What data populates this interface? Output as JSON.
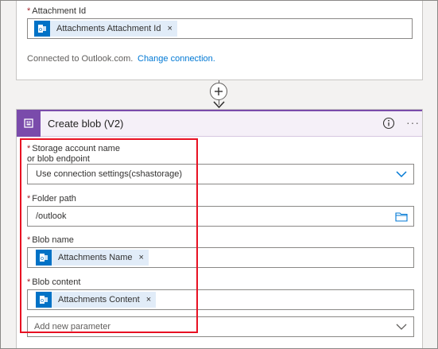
{
  "outlook_step": {
    "attachment_id": {
      "label": "Attachment Id",
      "required_mark": "*",
      "token_label": "Attachments Attachment Id",
      "token_remove": "×"
    },
    "connection_text": "Connected to Outlook.com.",
    "change_connection_link": "Change connection."
  },
  "create_blob_step": {
    "title": "Create blob (V2)",
    "more_label": "···",
    "fields": {
      "storage_account": {
        "required_mark": "*",
        "label_line1": "Storage account name",
        "label_line2": "or blob endpoint",
        "value": "Use connection settings(cshastorage)"
      },
      "folder_path": {
        "required_mark": "*",
        "label": "Folder path",
        "value": "/outlook"
      },
      "blob_name": {
        "required_mark": "*",
        "label": "Blob name",
        "token_label": "Attachments Name",
        "token_remove": "×"
      },
      "blob_content": {
        "required_mark": "*",
        "label": "Blob content",
        "token_label": "Attachments Content",
        "token_remove": "×"
      }
    },
    "add_parameter_placeholder": "Add new parameter"
  },
  "colors": {
    "outlook_blue": "#0072c6",
    "blob_purple": "#7a4bab",
    "link_blue": "#0078d4",
    "highlight_red": "#e81123"
  },
  "icons": {
    "token_icon": "outlook-icon",
    "step_icon": "blob-storage-icon",
    "folder_picker": "folder-icon",
    "dropdown": "chevron-down-icon",
    "info": "info-icon",
    "add_step": "plus-icon"
  }
}
